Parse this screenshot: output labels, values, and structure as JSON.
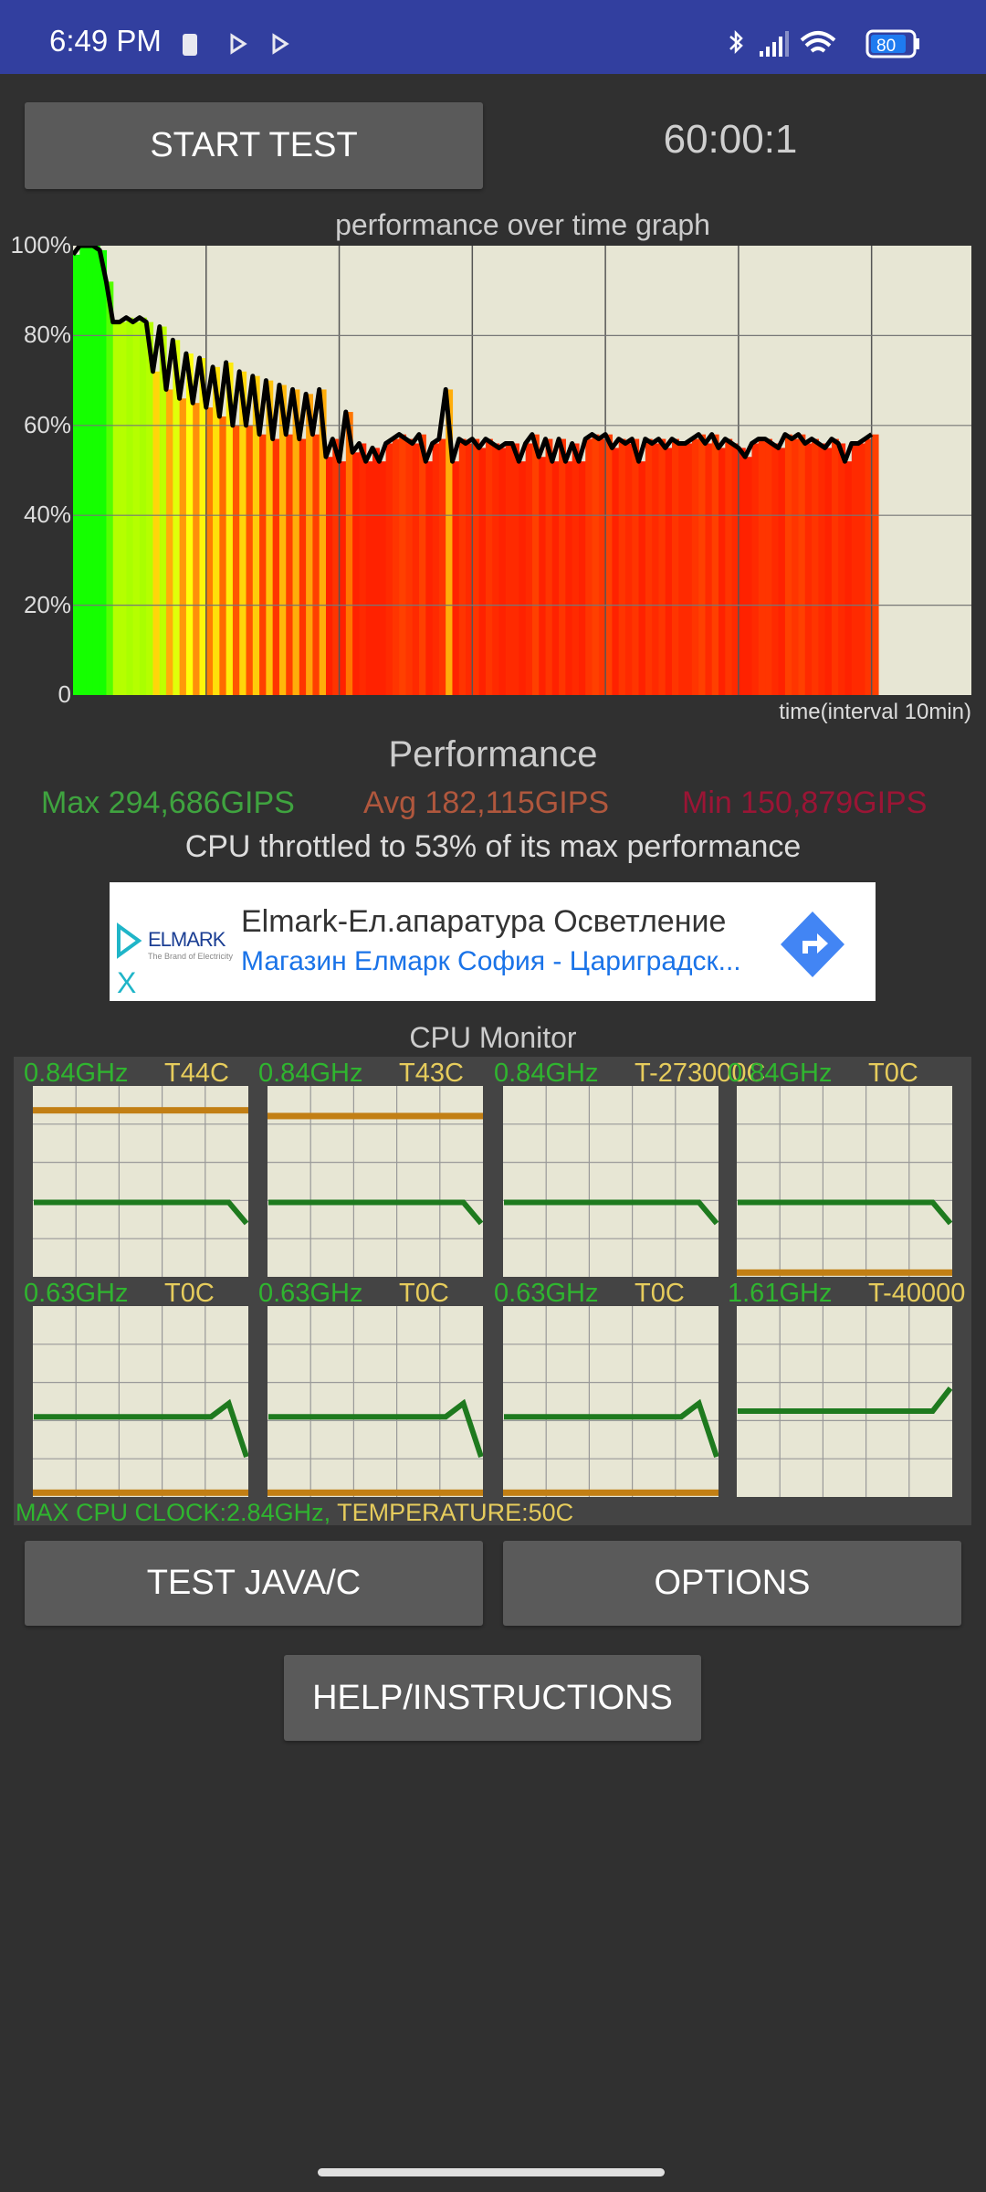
{
  "status_bar": {
    "time": "6:49 PM",
    "battery": "80",
    "icons": [
      "sim-icon",
      "play-store-icon",
      "play-store-icon",
      "bluetooth-icon",
      "signal-icon",
      "wifi-icon",
      "battery-icon"
    ]
  },
  "controls": {
    "start_label": "START TEST",
    "timer": "60:00:1"
  },
  "chart_data": {
    "type": "area",
    "title": "performance over time graph",
    "xlabel": "time(interval 10min)",
    "ylabel": "",
    "yticks": [
      "0",
      "20%",
      "40%",
      "60%",
      "80%",
      "100%"
    ],
    "ylim": [
      0,
      100
    ],
    "xlim": [
      0,
      67.5
    ],
    "x_grid_interval_min": 10,
    "grid": true,
    "fill_colors": {
      "high": "#33ff11",
      "mid": "#ffcc00",
      "low": "#ff3a00"
    },
    "line_color": "#000000",
    "x_step_min": 0.5,
    "values": [
      98,
      100,
      100,
      100,
      99,
      92,
      83,
      83,
      84,
      83,
      84,
      83,
      72,
      82,
      68,
      79,
      66,
      76,
      65,
      75,
      64,
      73,
      62,
      74,
      60,
      72,
      60,
      71,
      58,
      70,
      57,
      69,
      58,
      68,
      57,
      67,
      58,
      68,
      53,
      57,
      52,
      63,
      54,
      56,
      52,
      55,
      52,
      56,
      57,
      58,
      57,
      56,
      58,
      52,
      56,
      57,
      68,
      52,
      57,
      56,
      57,
      55,
      57,
      56,
      55,
      56,
      56,
      52,
      56,
      58,
      53,
      57,
      52,
      57,
      52,
      56,
      52,
      57,
      58,
      57,
      58,
      55,
      57,
      56,
      57,
      52,
      57,
      56,
      57,
      55,
      57,
      56,
      56,
      57,
      58,
      56,
      58,
      55,
      57,
      56,
      55,
      53,
      56,
      57,
      57,
      56,
      55,
      58,
      57,
      58,
      56,
      57,
      56,
      55,
      57,
      56,
      52,
      56,
      56,
      57,
      58
    ]
  },
  "performance": {
    "title": "Performance",
    "max": "Max 294,686GIPS",
    "avg": "Avg 182,115GIPS",
    "min": "Min 150,879GIPS",
    "throttle": "CPU throttled to 53% of its max performance",
    "colors": {
      "max": "#3fa33f",
      "avg": "#b0573d",
      "min": "#9a1535"
    }
  },
  "ad": {
    "logo": "ELMARK",
    "logo_tagline": "The Brand of Electricity",
    "title": "Elmark-Ел.апаратура Осветление",
    "subtitle": "Магазин Елмарк София - Цариградск...",
    "close": "X"
  },
  "cpu_monitor": {
    "title": "CPU Monitor",
    "cores": [
      {
        "freq": "0.84GHz",
        "temp": "T44C",
        "freq_history": [
          39,
          39,
          39,
          39,
          39,
          39,
          39,
          39,
          39,
          39,
          39,
          39,
          28
        ],
        "temp_level": 87
      },
      {
        "freq": "0.84GHz",
        "temp": "T43C",
        "freq_history": [
          39,
          39,
          39,
          39,
          39,
          39,
          39,
          39,
          39,
          39,
          39,
          39,
          28
        ],
        "temp_level": 84
      },
      {
        "freq": "0.84GHz",
        "temp": "T-273000C",
        "freq_history": [
          39,
          39,
          39,
          39,
          39,
          39,
          39,
          39,
          39,
          39,
          39,
          39,
          28
        ],
        "temp_level": null
      },
      {
        "freq": "0.84GHz",
        "temp": "T0C",
        "freq_history": [
          39,
          39,
          39,
          39,
          39,
          39,
          39,
          39,
          39,
          39,
          39,
          39,
          28
        ],
        "temp_level": 2
      },
      {
        "freq": "0.63GHz",
        "temp": "T0C",
        "freq_history": [
          42,
          42,
          42,
          42,
          42,
          42,
          42,
          42,
          42,
          42,
          42,
          49,
          21
        ],
        "temp_level": 2
      },
      {
        "freq": "0.63GHz",
        "temp": "T0C",
        "freq_history": [
          42,
          42,
          42,
          42,
          42,
          42,
          42,
          42,
          42,
          42,
          42,
          49,
          21
        ],
        "temp_level": 2
      },
      {
        "freq": "0.63GHz",
        "temp": "T0C",
        "freq_history": [
          42,
          42,
          42,
          42,
          42,
          42,
          42,
          42,
          42,
          42,
          42,
          49,
          21
        ],
        "temp_level": 2
      },
      {
        "freq": "1.61GHz",
        "temp": "T-40000",
        "freq_history": [
          45,
          45,
          45,
          45,
          45,
          45,
          45,
          45,
          45,
          45,
          45,
          45,
          57
        ],
        "temp_level": null
      }
    ],
    "footer_clock": "MAX CPU CLOCK:2.84GHz,",
    "footer_temp": "TEMPERATURE:50C"
  },
  "buttons": {
    "test_java": "TEST JAVA/C",
    "options": "OPTIONS",
    "help": "HELP/INSTRUCTIONS"
  }
}
